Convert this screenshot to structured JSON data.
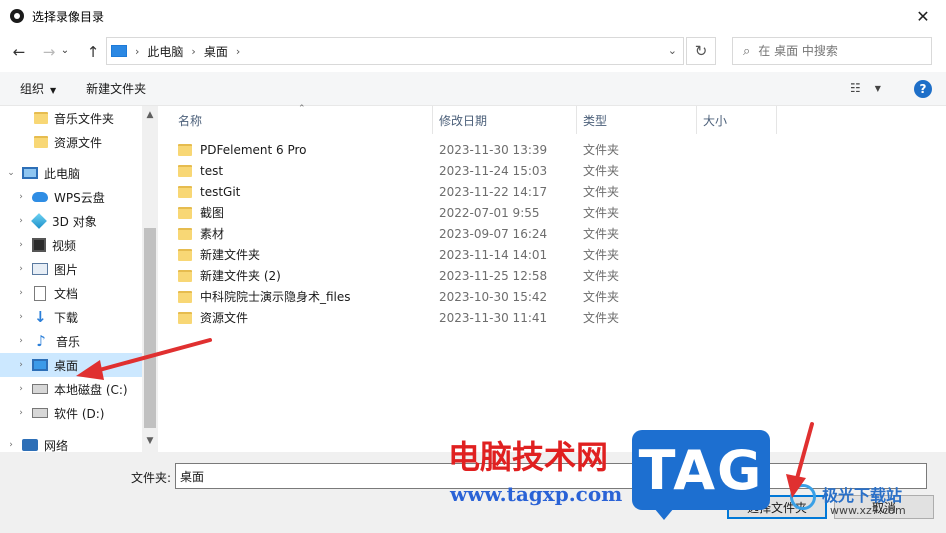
{
  "window": {
    "title": "选择录像目录",
    "close_glyph": "✕"
  },
  "nav": {
    "back_glyph": "←",
    "forward_glyph": "→",
    "recent_glyph": "⌄",
    "up_glyph": "↑",
    "breadcrumb": [
      "此电脑",
      "桌面"
    ],
    "crumb_sep": "›",
    "dropdown_glyph": "⌄",
    "refresh_glyph": "↻",
    "search_placeholder": "在 桌面 中搜索"
  },
  "toolbar": {
    "organize_label": "组织",
    "new_folder_label": "新建文件夹",
    "help_label": "?"
  },
  "sidebar": {
    "items": [
      {
        "label": "音乐文件夹",
        "icon": "folder-icon",
        "chevron": ""
      },
      {
        "label": "资源文件",
        "icon": "folder-icon",
        "chevron": ""
      },
      {
        "label": "此电脑",
        "icon": "pc-icon",
        "chevron": "⌄"
      },
      {
        "label": "WPS云盘",
        "icon": "cloud-icon",
        "chevron": "›"
      },
      {
        "label": "3D 对象",
        "icon": "3d-objects-icon",
        "chevron": "›"
      },
      {
        "label": "视频",
        "icon": "video-icon",
        "chevron": "›"
      },
      {
        "label": "图片",
        "icon": "pictures-icon",
        "chevron": "›"
      },
      {
        "label": "文档",
        "icon": "documents-icon",
        "chevron": "›"
      },
      {
        "label": "下载",
        "icon": "download-icon",
        "chevron": "›"
      },
      {
        "label": "音乐",
        "icon": "music-icon",
        "chevron": "›"
      },
      {
        "label": "桌面",
        "icon": "desktop-icon",
        "chevron": "›"
      },
      {
        "label": "本地磁盘 (C:)",
        "icon": "drive-icon",
        "chevron": "›"
      },
      {
        "label": "软件 (D:)",
        "icon": "drive-icon",
        "chevron": "›"
      },
      {
        "label": "网络",
        "icon": "network-icon",
        "chevron": "›"
      }
    ],
    "selected": "桌面"
  },
  "columns": {
    "name": "名称",
    "date": "修改日期",
    "type": "类型",
    "size": "大小"
  },
  "files": [
    {
      "name": "PDFelement 6 Pro",
      "date": "2023-11-30 13:39",
      "type": "文件夹"
    },
    {
      "name": "test",
      "date": "2023-11-24 15:03",
      "type": "文件夹"
    },
    {
      "name": "testGit",
      "date": "2023-11-22 14:17",
      "type": "文件夹"
    },
    {
      "name": "截图",
      "date": "2022-07-01 9:55",
      "type": "文件夹"
    },
    {
      "name": "素材",
      "date": "2023-09-07 16:24",
      "type": "文件夹"
    },
    {
      "name": "新建文件夹",
      "date": "2023-11-14 14:01",
      "type": "文件夹"
    },
    {
      "name": "新建文件夹 (2)",
      "date": "2023-11-25 12:58",
      "type": "文件夹"
    },
    {
      "name": "中科院院士演示隐身术_files",
      "date": "2023-10-30 15:42",
      "type": "文件夹"
    },
    {
      "name": "资源文件",
      "date": "2023-11-30 11:41",
      "type": "文件夹"
    }
  ],
  "footer": {
    "folder_label": "文件夹:",
    "folder_value": "桌面",
    "select_button": "选择文件夹",
    "cancel_button": "取消"
  },
  "watermark": {
    "brand_text": "电脑技术网",
    "url": "www.tagxp.com",
    "tag": "TAG",
    "site_name": "极光下载站",
    "site_url": "www.xz7.com"
  },
  "colors": {
    "accent": "#0078d7",
    "selection": "#cce8ff",
    "annotation_arrow": "#e03030"
  }
}
